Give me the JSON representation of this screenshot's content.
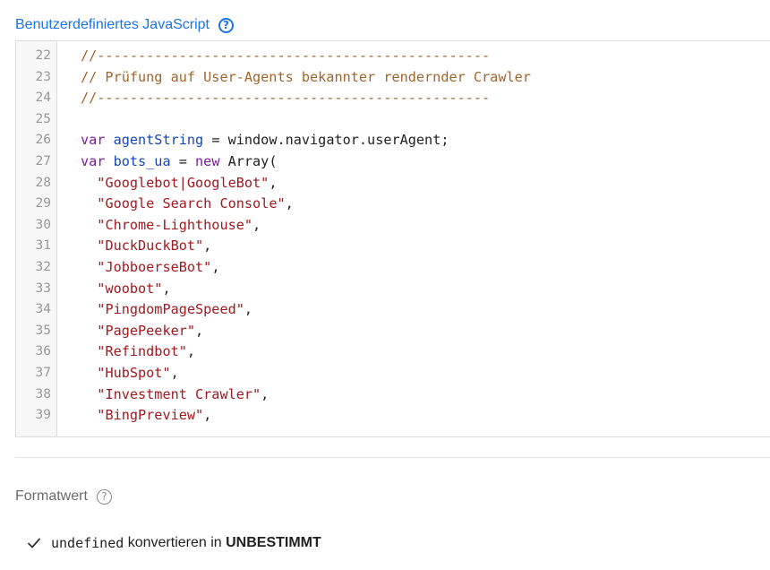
{
  "section": {
    "title": "Benutzerdefiniertes JavaScript",
    "help_icon": "help-circle-icon"
  },
  "editor": {
    "lines": [
      {
        "no": "22",
        "tokens": [
          {
            "t": "comment",
            "v": "//------------------------------------------------"
          }
        ]
      },
      {
        "no": "23",
        "tokens": [
          {
            "t": "comment",
            "v": "// Prüfung auf User-Agents bekannter rendernder Crawler"
          }
        ]
      },
      {
        "no": "24",
        "tokens": [
          {
            "t": "comment",
            "v": "//------------------------------------------------"
          }
        ]
      },
      {
        "no": "25",
        "tokens": []
      },
      {
        "no": "26",
        "tokens": [
          {
            "t": "keyword",
            "v": "var "
          },
          {
            "t": "def",
            "v": "agentString"
          },
          {
            "t": "plain",
            "v": " = window.navigator.userAgent;"
          }
        ]
      },
      {
        "no": "27",
        "tokens": [
          {
            "t": "keyword",
            "v": "var "
          },
          {
            "t": "def",
            "v": "bots_ua"
          },
          {
            "t": "plain",
            "v": " = "
          },
          {
            "t": "keyword",
            "v": "new "
          },
          {
            "t": "plain",
            "v": "Array("
          }
        ]
      },
      {
        "no": "28",
        "tokens": [
          {
            "t": "plain",
            "v": "  "
          },
          {
            "t": "string",
            "v": "\"Googlebot|GoogleBot\""
          },
          {
            "t": "plain",
            "v": ","
          }
        ]
      },
      {
        "no": "29",
        "tokens": [
          {
            "t": "plain",
            "v": "  "
          },
          {
            "t": "string",
            "v": "\"Google Search Console\""
          },
          {
            "t": "plain",
            "v": ","
          }
        ]
      },
      {
        "no": "30",
        "tokens": [
          {
            "t": "plain",
            "v": "  "
          },
          {
            "t": "string",
            "v": "\"Chrome-Lighthouse\""
          },
          {
            "t": "plain",
            "v": ","
          }
        ]
      },
      {
        "no": "31",
        "tokens": [
          {
            "t": "plain",
            "v": "  "
          },
          {
            "t": "string",
            "v": "\"DuckDuckBot\""
          },
          {
            "t": "plain",
            "v": ","
          }
        ]
      },
      {
        "no": "32",
        "tokens": [
          {
            "t": "plain",
            "v": "  "
          },
          {
            "t": "string",
            "v": "\"JobboerseBot\""
          },
          {
            "t": "plain",
            "v": ","
          }
        ]
      },
      {
        "no": "33",
        "tokens": [
          {
            "t": "plain",
            "v": "  "
          },
          {
            "t": "string",
            "v": "\"woobot\""
          },
          {
            "t": "plain",
            "v": ","
          }
        ]
      },
      {
        "no": "34",
        "tokens": [
          {
            "t": "plain",
            "v": "  "
          },
          {
            "t": "string",
            "v": "\"PingdomPageSpeed\""
          },
          {
            "t": "plain",
            "v": ","
          }
        ]
      },
      {
        "no": "35",
        "tokens": [
          {
            "t": "plain",
            "v": "  "
          },
          {
            "t": "string",
            "v": "\"PagePeeker\""
          },
          {
            "t": "plain",
            "v": ","
          }
        ]
      },
      {
        "no": "36",
        "tokens": [
          {
            "t": "plain",
            "v": "  "
          },
          {
            "t": "string",
            "v": "\"Refindbot\""
          },
          {
            "t": "plain",
            "v": ","
          }
        ]
      },
      {
        "no": "37",
        "tokens": [
          {
            "t": "plain",
            "v": "  "
          },
          {
            "t": "string",
            "v": "\"HubSpot\""
          },
          {
            "t": "plain",
            "v": ","
          }
        ]
      },
      {
        "no": "38",
        "tokens": [
          {
            "t": "plain",
            "v": "  "
          },
          {
            "t": "string",
            "v": "\"Investment Crawler\""
          },
          {
            "t": "plain",
            "v": ","
          }
        ]
      },
      {
        "no": "39",
        "tokens": [
          {
            "t": "plain",
            "v": "  "
          },
          {
            "t": "string",
            "v": "\"BingPreview\""
          },
          {
            "t": "plain",
            "v": ","
          }
        ]
      }
    ]
  },
  "format": {
    "title": "Formatwert",
    "help_icon": "help-circle-icon",
    "option": {
      "check_icon": "checkmark-icon",
      "code": "undefined",
      "middle": " konvertieren in ",
      "target": "UNBESTIMMT"
    }
  },
  "colors": {
    "accent": "#1a73e8",
    "comment": "#a0652b",
    "keyword": "#7d1c9c",
    "definition": "#1547b8",
    "string": "#a1191f"
  }
}
